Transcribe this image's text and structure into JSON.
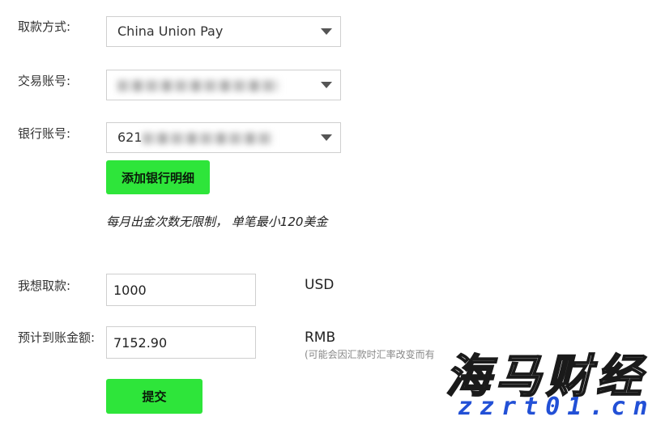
{
  "form": {
    "method": {
      "label": "取款方式:",
      "selected": "China Union Pay"
    },
    "trading_account": {
      "label": "交易账号:"
    },
    "bank_account": {
      "label": "银行账号:",
      "visible_prefix": "621"
    },
    "add_bank_button": "添加银行明细",
    "note": "每月出金次数无限制， 单笔最小120美金",
    "amount": {
      "label": "我想取款:",
      "value": "1000",
      "unit": "USD"
    },
    "estimate": {
      "label": "预计到账金额:",
      "value": "7152.90",
      "unit": "RMB",
      "subnote": "(可能会因汇款时汇率改变而有"
    },
    "submit_button": "提交"
  },
  "watermark": {
    "text": "海马财经",
    "url": "zzrt01.cn"
  },
  "colors": {
    "button_green": "#2ee53a",
    "watermark_blue": "#2250d6"
  }
}
